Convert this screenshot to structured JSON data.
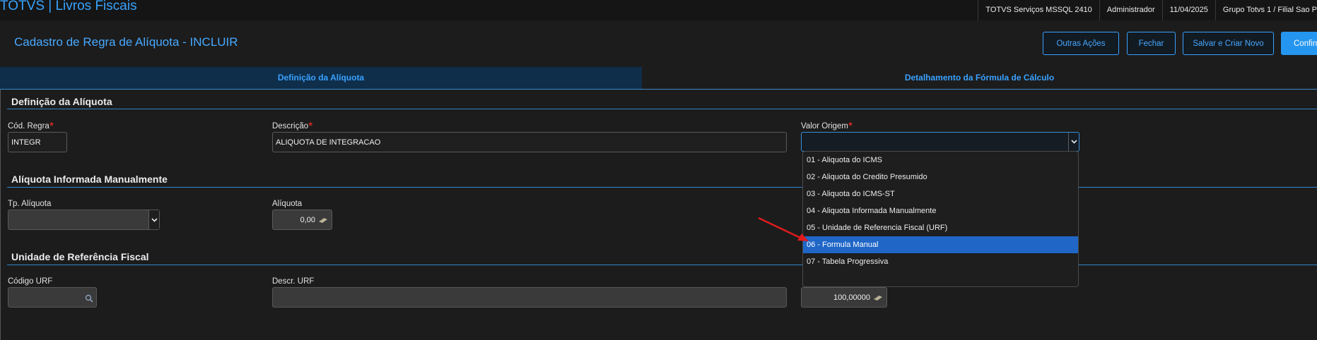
{
  "app": {
    "title": "TOTVS | Livros Fiscais",
    "server": "TOTVS Serviços MSSQL 2410",
    "user": "Administrador",
    "date": "11/04/2025",
    "branch": "Grupo Totvs 1 / Filial Sao P"
  },
  "page": {
    "title": "Cadastro de Regra de Alíquota - INCLUIR",
    "buttons": {
      "other_actions": "Outras Ações",
      "close": "Fechar",
      "save_new": "Salvar e Criar Novo",
      "confirm": "Confirm"
    }
  },
  "tabs": [
    {
      "label": "Definição da Alíquota",
      "active": true
    },
    {
      "label": "Detalhamento da Fórmula de Cálculo",
      "active": false
    }
  ],
  "sections": {
    "definicao": {
      "title": "Definição da Alíquota",
      "cod_regra": {
        "label": "Cód. Regra",
        "value": "INTEGR"
      },
      "descricao": {
        "label": "Descrição",
        "value": "ALIQUOTA DE INTEGRACAO"
      },
      "valor_origem": {
        "label": "Valor Origem",
        "value": ""
      }
    },
    "manual": {
      "title": "Alíquota Informada Manualmente",
      "tp_aliquota": {
        "label": "Tp. Alíquota",
        "value": ""
      },
      "aliquota": {
        "label": "Alíquota",
        "value": "0,00"
      }
    },
    "urf": {
      "title": "Unidade de Referência Fiscal",
      "codigo_urf": {
        "label": "Código URF",
        "value": ""
      },
      "descr_urf": {
        "label": "Descr. URF",
        "value": ""
      },
      "percentual": {
        "value": "100,00000"
      }
    }
  },
  "dropdown": {
    "options": [
      "01 - Aliquota do ICMS",
      "02 - Aliquota do Credito Presumido",
      "03 - Aliquota do ICMS-ST",
      "04 - Aliquota Informada Manualmente",
      "05 - Unidade de Referencia Fiscal (URF)",
      "06 - Formula Manual",
      "07 - Tabela Progressiva"
    ],
    "highlighted_index": 5
  },
  "colors": {
    "accent": "#3aa1ff",
    "required": "#ff2b2b",
    "highlight": "#1f66c7",
    "annotation_arrow": "#e01b1b"
  },
  "icons": [
    "chevron-down-icon",
    "money-icon",
    "search-icon",
    "annotation-arrow"
  ]
}
